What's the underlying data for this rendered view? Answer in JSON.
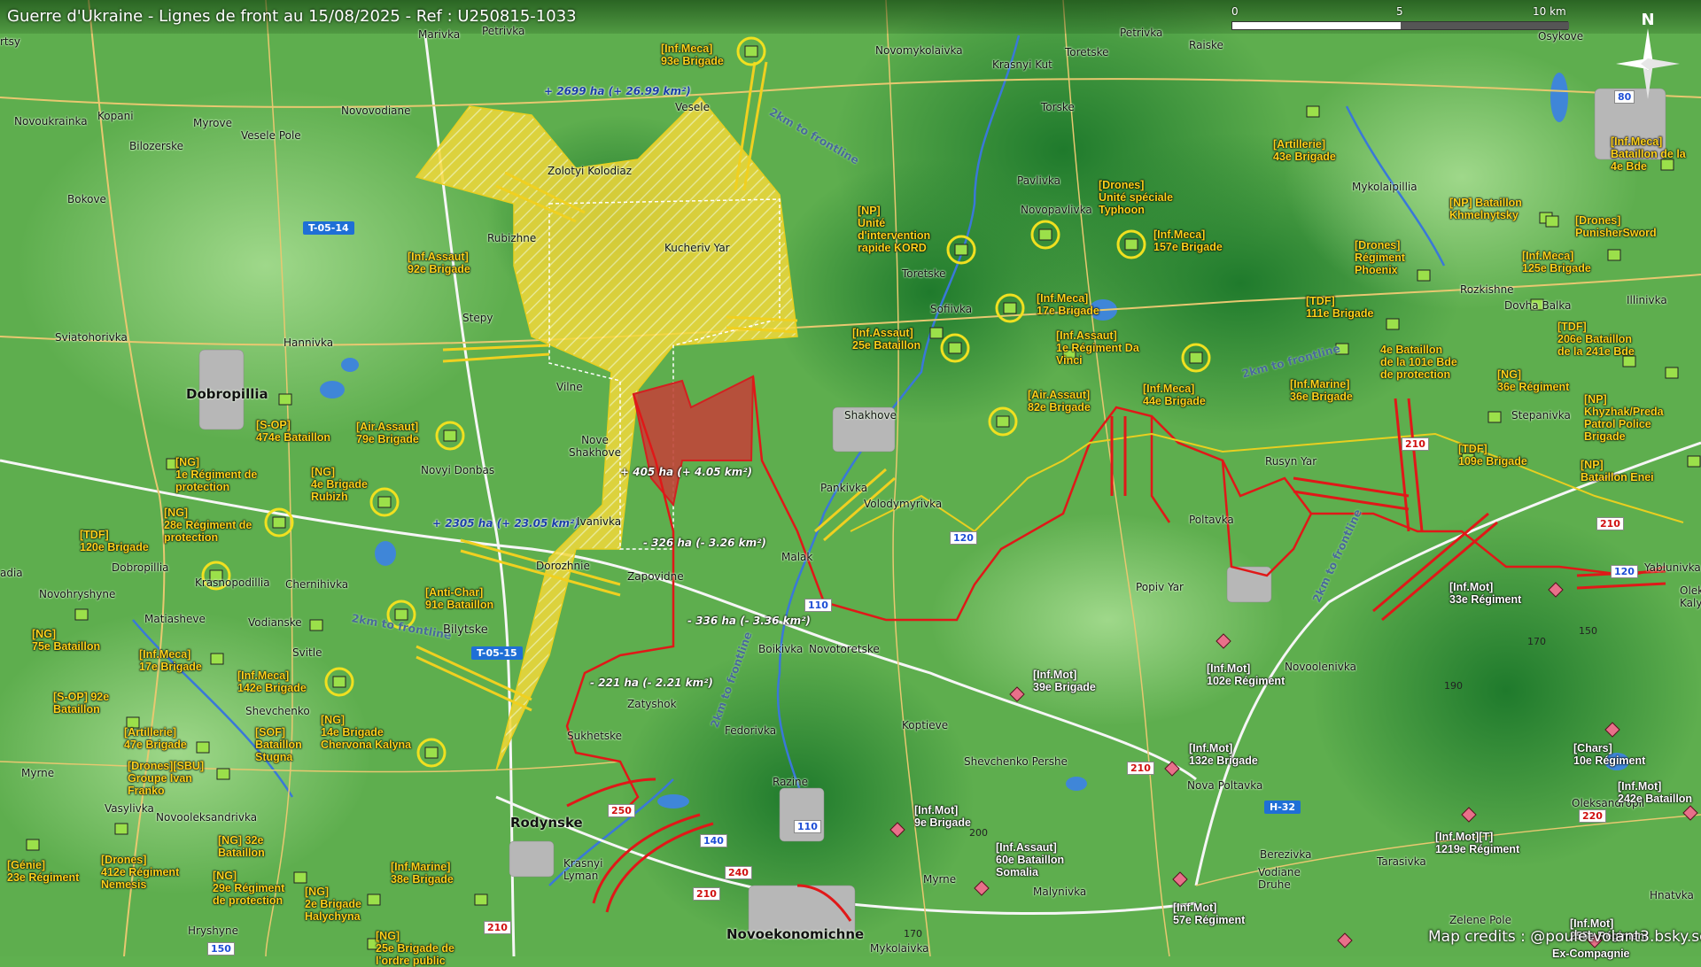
{
  "title": "Guerre d'Ukraine - Lignes de front au 15/08/2025 - Ref : U250815-1033",
  "credits": "Map credits : @pouletvolant3.bsky.social",
  "scale": {
    "labels": [
      "0",
      "5",
      "10 km"
    ]
  },
  "compass": {
    "label": "N"
  },
  "colors": {
    "ukraine_units": "#ffd21c",
    "russia_frontline": "#e01818",
    "ua_advance_fill": "#f2d83a",
    "ru_occupied_fill": "#c0463a"
  },
  "places": {
    "dobropillia": "Dobropillia",
    "rodynske": "Rodynske",
    "novoekonomichne": "Novoekonomichne",
    "zolotyi": "Zolotyi Kolodiaz",
    "kucheriv": "Kucheriv Yar",
    "rubizhne": "Rubizhne",
    "vesele": "Vesele",
    "novovodiane": "Novovodiane",
    "novoukrainka": "Novoukrainka",
    "kopani": "Kopani",
    "myrove": "Myrove",
    "vesele_pole": "Vesele Pole",
    "bilozerske": "Bilozerske",
    "bokove": "Bokove",
    "sviatohorivka": "Sviatohorivka",
    "hannivka": "Hannivka",
    "stepy": "Stepy",
    "vilne": "Vilne",
    "nove_shakhove": "Nove\nShakhove",
    "novyi_donbas": "Novyi Donbas",
    "ivanivka": "Ivanivka",
    "dorozhnie": "Dorozhnie",
    "zapovidne": "Zapovidne",
    "bilytske": "Bilytske",
    "krasnopodillia": "Krasnopodillia",
    "chernihivka": "Chernihivka",
    "vodianske": "Vodianske",
    "svitle": "Svitle",
    "shevchenko": "Shevchenko",
    "matiasheve": "Matiasheve",
    "novohryshyne": "Novohryshyne",
    "dobropillia_small": "Dobropillia",
    "myrne": "Myrne",
    "vasylivka": "Vasylivka",
    "novooleksandrivka": "Novooleksandrivka",
    "hryshyne": "Hryshyne",
    "sukhetske": "Sukhetske",
    "zatyshok": "Zatyshok",
    "fedorivka": "Fedorivka",
    "razine": "Razine",
    "krasnyi_lyman": "Krasnyi\nLyman",
    "boikivka": "Boikivka",
    "novotoretske": "Novotoretske",
    "malak": "Malak",
    "pankivka": "Pankivka",
    "volodymyrivka": "Volodymyrivka",
    "shakhove": "Shakhove",
    "sofiivka": "Sofiivka",
    "toretske": "Toretske",
    "poltavka": "Poltavka",
    "popiv_yar": "Popiv Yar",
    "rusyn_yar": "Rusyn Yar",
    "koptieve": "Koptieve",
    "shevchenko_pershe": "Shevchenko Pershe",
    "nova_poltavka": "Nova Poltavka",
    "novoolenivka": "Novoolenivka",
    "pavlivka": "Pavlivka",
    "novopavlivka": "Novopavlivka",
    "torske": "Torske",
    "toretske_n": "Toretske",
    "novomykolaivka": "Novomykolaivka",
    "krasnyi_kut": "Krasnyi Kut",
    "petrivka_n": "Petrivka",
    "petrivka": "Petrivka",
    "raiske": "Raiske",
    "marivka": "Marivka",
    "osykove": "Osykove",
    "mykolaipillia": "Mykolaipillia",
    "rozkishne": "Rozkishne",
    "dovha_balka": "Dovha Balka",
    "illinivka": "Illinivka",
    "stepanivka": "Stepanivka",
    "yablunivka": "Yablunivka",
    "oleksandropil": "Oleksandropil",
    "berezivka": "Berezivka",
    "vodiane_druhe": "Vodiane\nDruhe",
    "tarasivka": "Tarasivka",
    "zelene_pole": "Zelene Pole",
    "malynivka": "Malynivka",
    "myrne2": "Myrne",
    "mykolaivka": "Mykolaivka",
    "hnatvka": "Hnatvka",
    "oleksandrivka_k": "Oleks\nKalyn",
    "tsiadia": "adia",
    "ntsy": "rtsy"
  },
  "roads": {
    "t0514": "T-05-14",
    "t0515": "T-05-15",
    "h32": "H-32"
  },
  "road_numbers": {
    "r250": "250",
    "r240": "240",
    "r210a": "210",
    "r210b": "210",
    "r210c": "210",
    "r210d": "210",
    "r210e": "210",
    "r220": "220",
    "r140": "140",
    "r110a": "110",
    "r110b": "110",
    "r120a": "120",
    "r120b": "120",
    "r80": "80",
    "r150": "150",
    "r170": "170"
  },
  "elevations": {
    "e170": "170",
    "e150": "150",
    "e190": "190",
    "e200": "200"
  },
  "areas": {
    "gain1": "+ 2699 ha (+ 26.99 km²)",
    "gain2": "+ 2305 ha (+ 23.05 km²)",
    "gain3": "+ 405 ha (+ 4.05 km²)",
    "loss1": "- 326 ha (- 3.26 km²)",
    "loss2": "- 336 ha (- 3.36 km²)",
    "loss3": "- 221 ha (- 2.21 km²)"
  },
  "distances": {
    "d1": "2km to frontline",
    "d2": "2km to frontline",
    "d3": "2km to frontline",
    "d4": "2km to frontline",
    "d5": "2km to frontline"
  },
  "ua_units": {
    "u1": "[Inf.Meca]\n93e Brigade",
    "u2": "[Inf.Assaut]\n92e Brigade",
    "u3": "[NP]\nUnité\nd'intervention\nrapide KORD",
    "u4": "[Drones]\nUnité spéciale\nTyphoon",
    "u5": "[Inf.Meca]\n157e Brigade",
    "u6": "[Inf.Meca]\n17e Brigade",
    "u7": "[Inf.Assaut]\n25e Bataillon",
    "u8": "[Inf.Assaut]\n1e Régiment Da\nVinci",
    "u9": "[Air.Assaut]\n82e Brigade",
    "u10": "[Inf.Meca]\n44e Brigade",
    "u11": "[Inf.Marine]\n36e Brigade",
    "u12": "[Artillerie]\n43e Brigade",
    "u13": "[Drones]\nRégiment\nPhoenix",
    "u14": "[TDF]\n111e Brigade",
    "u15": "[NP] Bataillon\nKhmelnytsky",
    "u16": "[Drones]\nPunisherSword",
    "u17": "[Inf.Meca]\n125e Brigade",
    "u18": "[Inf.Meca]\nBataillon de la\n4e Bde",
    "u19": "[TDF]\n206e Bataillon\nde la 241e Bde",
    "u20": "4e Bataillon\nde la 101e Bde\nde protection",
    "u21": "[NG]\n36e Régiment",
    "u22": "[NP]\nKhyzhak/Preda\nPatrol Police\nBrigade",
    "u23": "[TDF]\n109e Brigade",
    "u24": "[NP]\nBataillon Enei",
    "u25": "[S-OP]\n474e Bataillon",
    "u26": "[Air.Assaut]\n79e Brigade",
    "u27": "[NG]\n1e Régiment de\nprotection",
    "u28": "[NG]\n4e Brigade\nRubizh",
    "u29": "[NG]\n28e Régiment de\nprotection",
    "u30": "[TDF]\n120e Brigade",
    "u31": "[Anti-Char]\n91e Bataillon",
    "u32": "[NG]\n75e Bataillon",
    "u33": "[Inf.Meca]\n17e Brigade",
    "u34": "[Inf.Meca]\n142e Brigade",
    "u35": "[S-OP] 92e\nBataillon",
    "u36": "[Artillerie]\n47e Brigade",
    "u37": "[NG]\n14e Brigade\nChervona Kalyna",
    "u38": "[SOF]\nBataillon\nStugna",
    "u39": "[Drones][SBU]\nGroupe Ivan\nFranko",
    "u40": "[NG] 32e\nBataillon",
    "u41": "[Génie]\n23e Régiment",
    "u42": "[Drones]\n412e Régiment\nNemesis",
    "u43": "[NG]\n29e Régiment\nde protection",
    "u44": "[NG]\n2e Brigade\nHalychyna",
    "u45": "[Inf.Marine]\n38e Brigade",
    "u46": "[NG]\n25e Brigade de\nl'ordre public"
  },
  "ru_units": {
    "r1": "[Inf.Mot]\n33e Régiment",
    "r2": "[Inf.Mot]\n102e Régiment",
    "r3": "[Inf.Mot]\n39e Brigade",
    "r4": "[Inf.Mot]\n132e Brigade",
    "r5": "[Inf.Mot]\n9e Brigade",
    "r6": "[Inf.Assaut]\n60e Bataillon\nSomalia",
    "r7": "[Inf.Mot]\n57e Régiment",
    "r8": "[Chars]\n10e Régiment",
    "r9": "[Inf.Mot]\n242e Bataillon",
    "r10": "[Inf.Mot][T]\n1219e Régiment",
    "r11": "[Inf.Mot]\n255e Régiment",
    "r12": "Ex-Compagnie"
  }
}
